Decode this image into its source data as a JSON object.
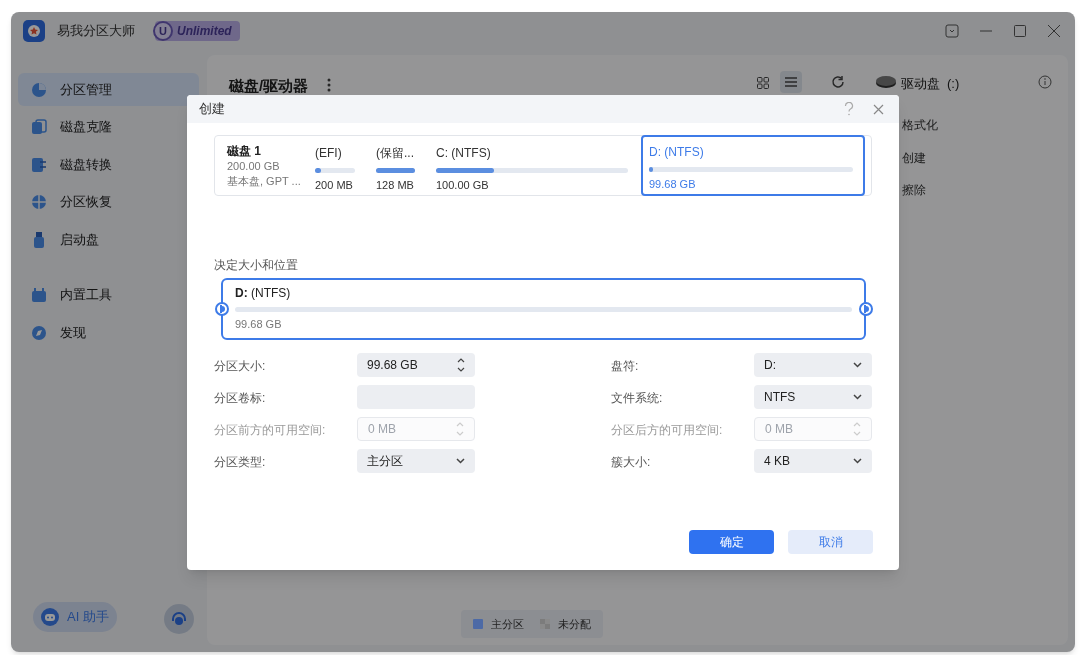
{
  "app": {
    "title": "易我分区大师",
    "badge_letter": "U",
    "badge": "Unlimited"
  },
  "sidebar": {
    "groups": [
      [
        {
          "label": "分区管理",
          "selected": true
        },
        {
          "label": "磁盘克隆",
          "selected": false
        },
        {
          "label": "磁盘转换",
          "selected": false
        },
        {
          "label": "分区恢复",
          "selected": false
        },
        {
          "label": "启动盘",
          "selected": false
        }
      ],
      [
        {
          "label": "内置工具",
          "selected": false
        },
        {
          "label": "发现",
          "selected": false
        }
      ]
    ],
    "ai_button": "AI 助手"
  },
  "main": {
    "title": "磁盘/驱动器",
    "view_list_selected": true,
    "drive": {
      "name": "驱动盘",
      "letter": "(:)"
    },
    "actions": [
      "格式化",
      "创建",
      "擦除"
    ],
    "legend": [
      {
        "label": "主分区",
        "kind": "solid",
        "color": "#4d6aa6"
      },
      {
        "label": "未分配",
        "kind": "checker",
        "color": "#7c7c7c"
      }
    ]
  },
  "dialog": {
    "title": "创建",
    "disk": {
      "name": "磁盘 1",
      "size": "200.00 GB",
      "info": "基本盘, GPT ..."
    },
    "partitions": [
      {
        "label": "(EFI)",
        "size": "200 MB",
        "level": 0.15,
        "selected": false
      },
      {
        "label": "(保留...",
        "size": "128 MB",
        "level": 1,
        "selected": false
      },
      {
        "label": "C: (NTFS)",
        "size": "100.00 GB",
        "level": 0.3,
        "selected": false
      },
      {
        "label": "D: (NTFS)",
        "size": "99.68 GB",
        "level": 0.01,
        "selected": true
      }
    ],
    "section_label": "决定大小和位置",
    "slider": {
      "letter": "D:",
      "fs": "(NTFS)",
      "size": "99.68 GB"
    },
    "fields": [
      [
        {
          "label": "分区大小:",
          "kind": "spin",
          "value": "99.68 GB",
          "disabled": false
        },
        {
          "label": "分区卷标:",
          "kind": "text",
          "disabled": false
        },
        {
          "label": "分区前方的可用空间:",
          "kind": "spin",
          "value": "0 MB",
          "disabled": true
        },
        {
          "label": "分区类型:",
          "kind": "select",
          "value": "主分区",
          "disabled": false
        }
      ],
      [
        {
          "label": "盘符:",
          "kind": "select",
          "value": "D:",
          "disabled": false
        },
        {
          "label": "文件系统:",
          "kind": "select",
          "value": "NTFS",
          "disabled": false
        },
        {
          "label": "分区后方的可用空间:",
          "kind": "spin",
          "value": "0 MB",
          "disabled": true
        },
        {
          "label": "簇大小:",
          "kind": "select",
          "value": "4 KB",
          "disabled": false
        }
      ]
    ],
    "buttons": [
      {
        "label": "确定",
        "kind": "primary"
      },
      {
        "label": "取消",
        "kind": "secondary"
      }
    ]
  }
}
